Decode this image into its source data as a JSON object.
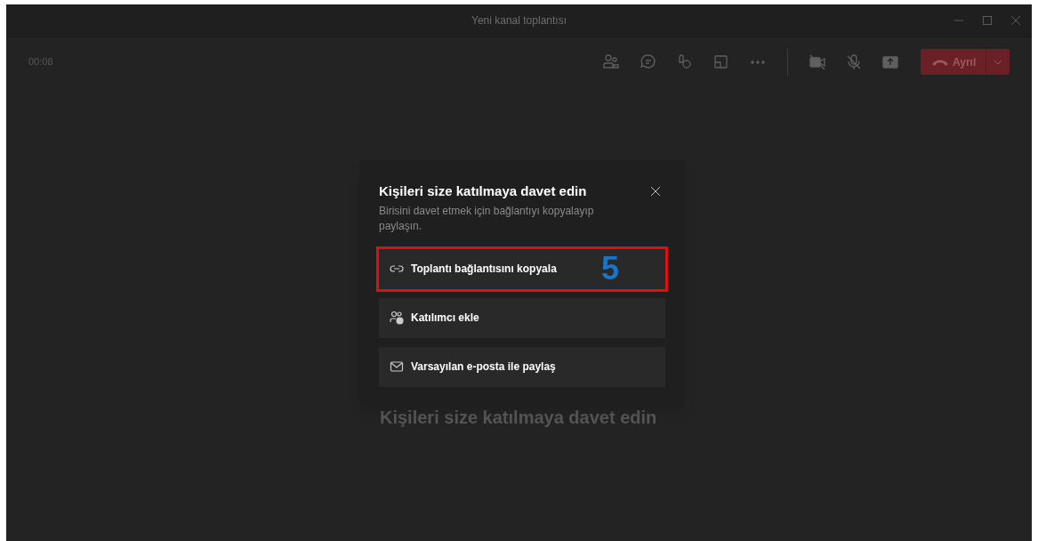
{
  "window": {
    "title": "Yeni kanal toplantısı"
  },
  "toolbar": {
    "timer": "00:08",
    "tools": [
      {
        "kind": "people"
      },
      {
        "kind": "chat"
      },
      {
        "kind": "reactions"
      },
      {
        "kind": "rooms"
      },
      {
        "kind": "more"
      },
      {
        "kind": "divider"
      },
      {
        "kind": "camera"
      },
      {
        "kind": "mic"
      },
      {
        "kind": "share"
      }
    ],
    "leave_button": {
      "label": "Ayrıl"
    }
  },
  "stage": {
    "text": "Kişileri size katılmaya davet edin"
  },
  "dialog": {
    "title": "Kişileri size katılmaya davet edin",
    "subtitle": "Birisini davet etmek için bağlantıyı kopyalayıp paylaşın.",
    "options": [
      {
        "kind": "link",
        "label": "Toplantı bağlantısını kopyala",
        "highlighted": true,
        "annotation": "5"
      },
      {
        "kind": "people",
        "label": "Katılımcı ekle",
        "highlighted": false
      },
      {
        "kind": "mail",
        "label": "Varsayılan e-posta ile paylaş",
        "highlighted": false
      }
    ]
  }
}
